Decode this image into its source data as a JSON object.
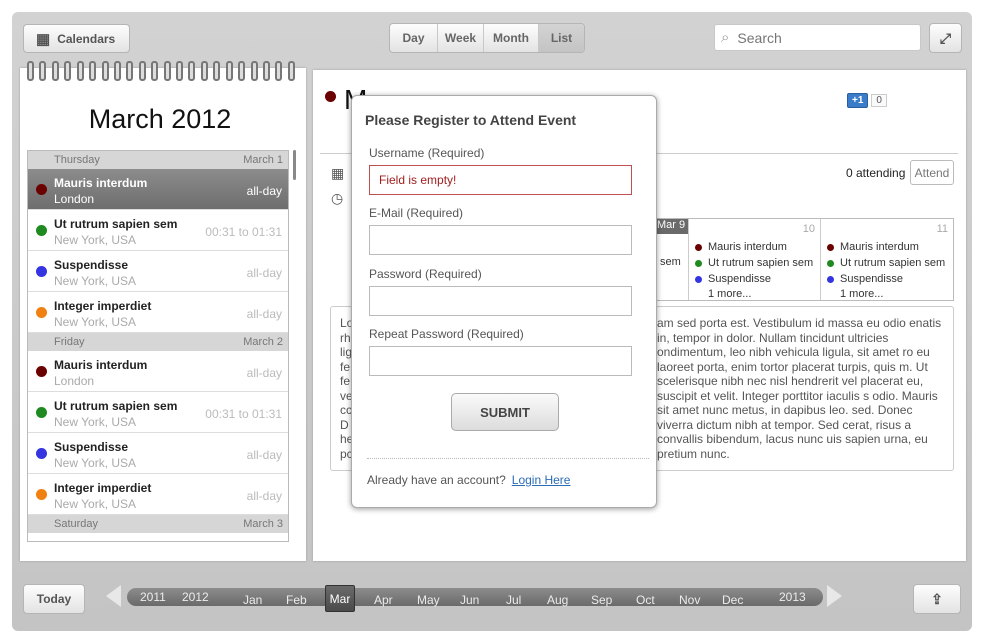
{
  "toolbar": {
    "calendars_label": "Calendars",
    "views": [
      "Day",
      "Week",
      "Month",
      "List"
    ],
    "search_placeholder": "Search"
  },
  "sidebar": {
    "month_title": "March 2012",
    "days": [
      {
        "weekday": "Thursday",
        "date": "March 1",
        "events": [
          {
            "title": "Mauris interdum",
            "location": "London",
            "time": "all-day",
            "color": "#6b0000",
            "selected": true
          },
          {
            "title": "Ut rutrum sapien sem",
            "location": "New York, USA",
            "time": "00:31 to 01:31",
            "color": "#1f8a1f"
          },
          {
            "title": "Suspendisse",
            "location": "New York, USA",
            "time": "all-day",
            "color": "#3434e0"
          },
          {
            "title": "Integer imperdiet",
            "location": "New York, USA",
            "time": "all-day",
            "color": "#f08010"
          }
        ]
      },
      {
        "weekday": "Friday",
        "date": "March 2",
        "events": [
          {
            "title": "Mauris interdum",
            "location": "London",
            "time": "all-day",
            "color": "#6b0000"
          },
          {
            "title": "Ut rutrum sapien sem",
            "location": "New York, USA",
            "time": "00:31 to 01:31",
            "color": "#1f8a1f"
          },
          {
            "title": "Suspendisse",
            "location": "New York, USA",
            "time": "all-day",
            "color": "#3434e0"
          },
          {
            "title": "Integer imperdiet",
            "location": "New York, USA",
            "time": "all-day",
            "color": "#f08010"
          }
        ]
      },
      {
        "weekday": "Saturday",
        "date": "March 3",
        "events": []
      }
    ]
  },
  "detail": {
    "title_partial": "M",
    "gplus": "+1",
    "gplus_count": "0",
    "attending": "0 attending",
    "attend_label": "Attend",
    "week": {
      "col_mar9": "Mar 9",
      "col_sem": "sem",
      "days": [
        {
          "num": "10",
          "items": [
            "Mauris interdum",
            "Ut rutrum sapien sem",
            "Suspendisse"
          ],
          "more": "1 more..."
        },
        {
          "num": "11",
          "items": [
            "Mauris interdum",
            "Ut rutrum sapien sem",
            "Suspendisse"
          ],
          "more": "1 more..."
        }
      ]
    },
    "desc_left": [
      "Lo",
      "rh",
      "lig",
      "fe",
      "fe",
      "ve",
      "cc",
      "D",
      "he",
      "pc"
    ],
    "description": "am sed porta est. Vestibulum id massa eu odio enatis in, tempor in dolor. Nullam tincidunt ultricies ondimentum, leo nibh vehicula ligula, sit amet ro eu laoreet porta, enim tortor placerat turpis, quis m. Ut scelerisque nibh nec nisl hendrerit vel placerat eu, suscipit et velit. Integer porttitor iaculis s odio. Mauris sit amet nunc metus, in dapibus leo. sed. Donec viverra dictum nibh at tempor. Sed cerat, risus a convallis bibendum, lacus nunc uis sapien urna, eu pretium nunc."
  },
  "modal": {
    "title": "Please Register to Attend Event",
    "username_label": "Username (Required)",
    "username_value": "Field is empty!",
    "email_label": "E-Mail (Required)",
    "password_label": "Password (Required)",
    "repeat_label": "Repeat Password (Required)",
    "submit": "SUBMIT",
    "already": "Already have an account?",
    "login": "Login Here"
  },
  "bottom": {
    "today": "Today",
    "years": [
      "2011",
      "2012"
    ],
    "months": [
      "Jan",
      "Feb",
      "Mar",
      "Apr",
      "May",
      "Jun",
      "Jul",
      "Aug",
      "Sep",
      "Oct",
      "Nov",
      "Dec"
    ],
    "next_year": "2013",
    "selected_month": "Mar"
  }
}
